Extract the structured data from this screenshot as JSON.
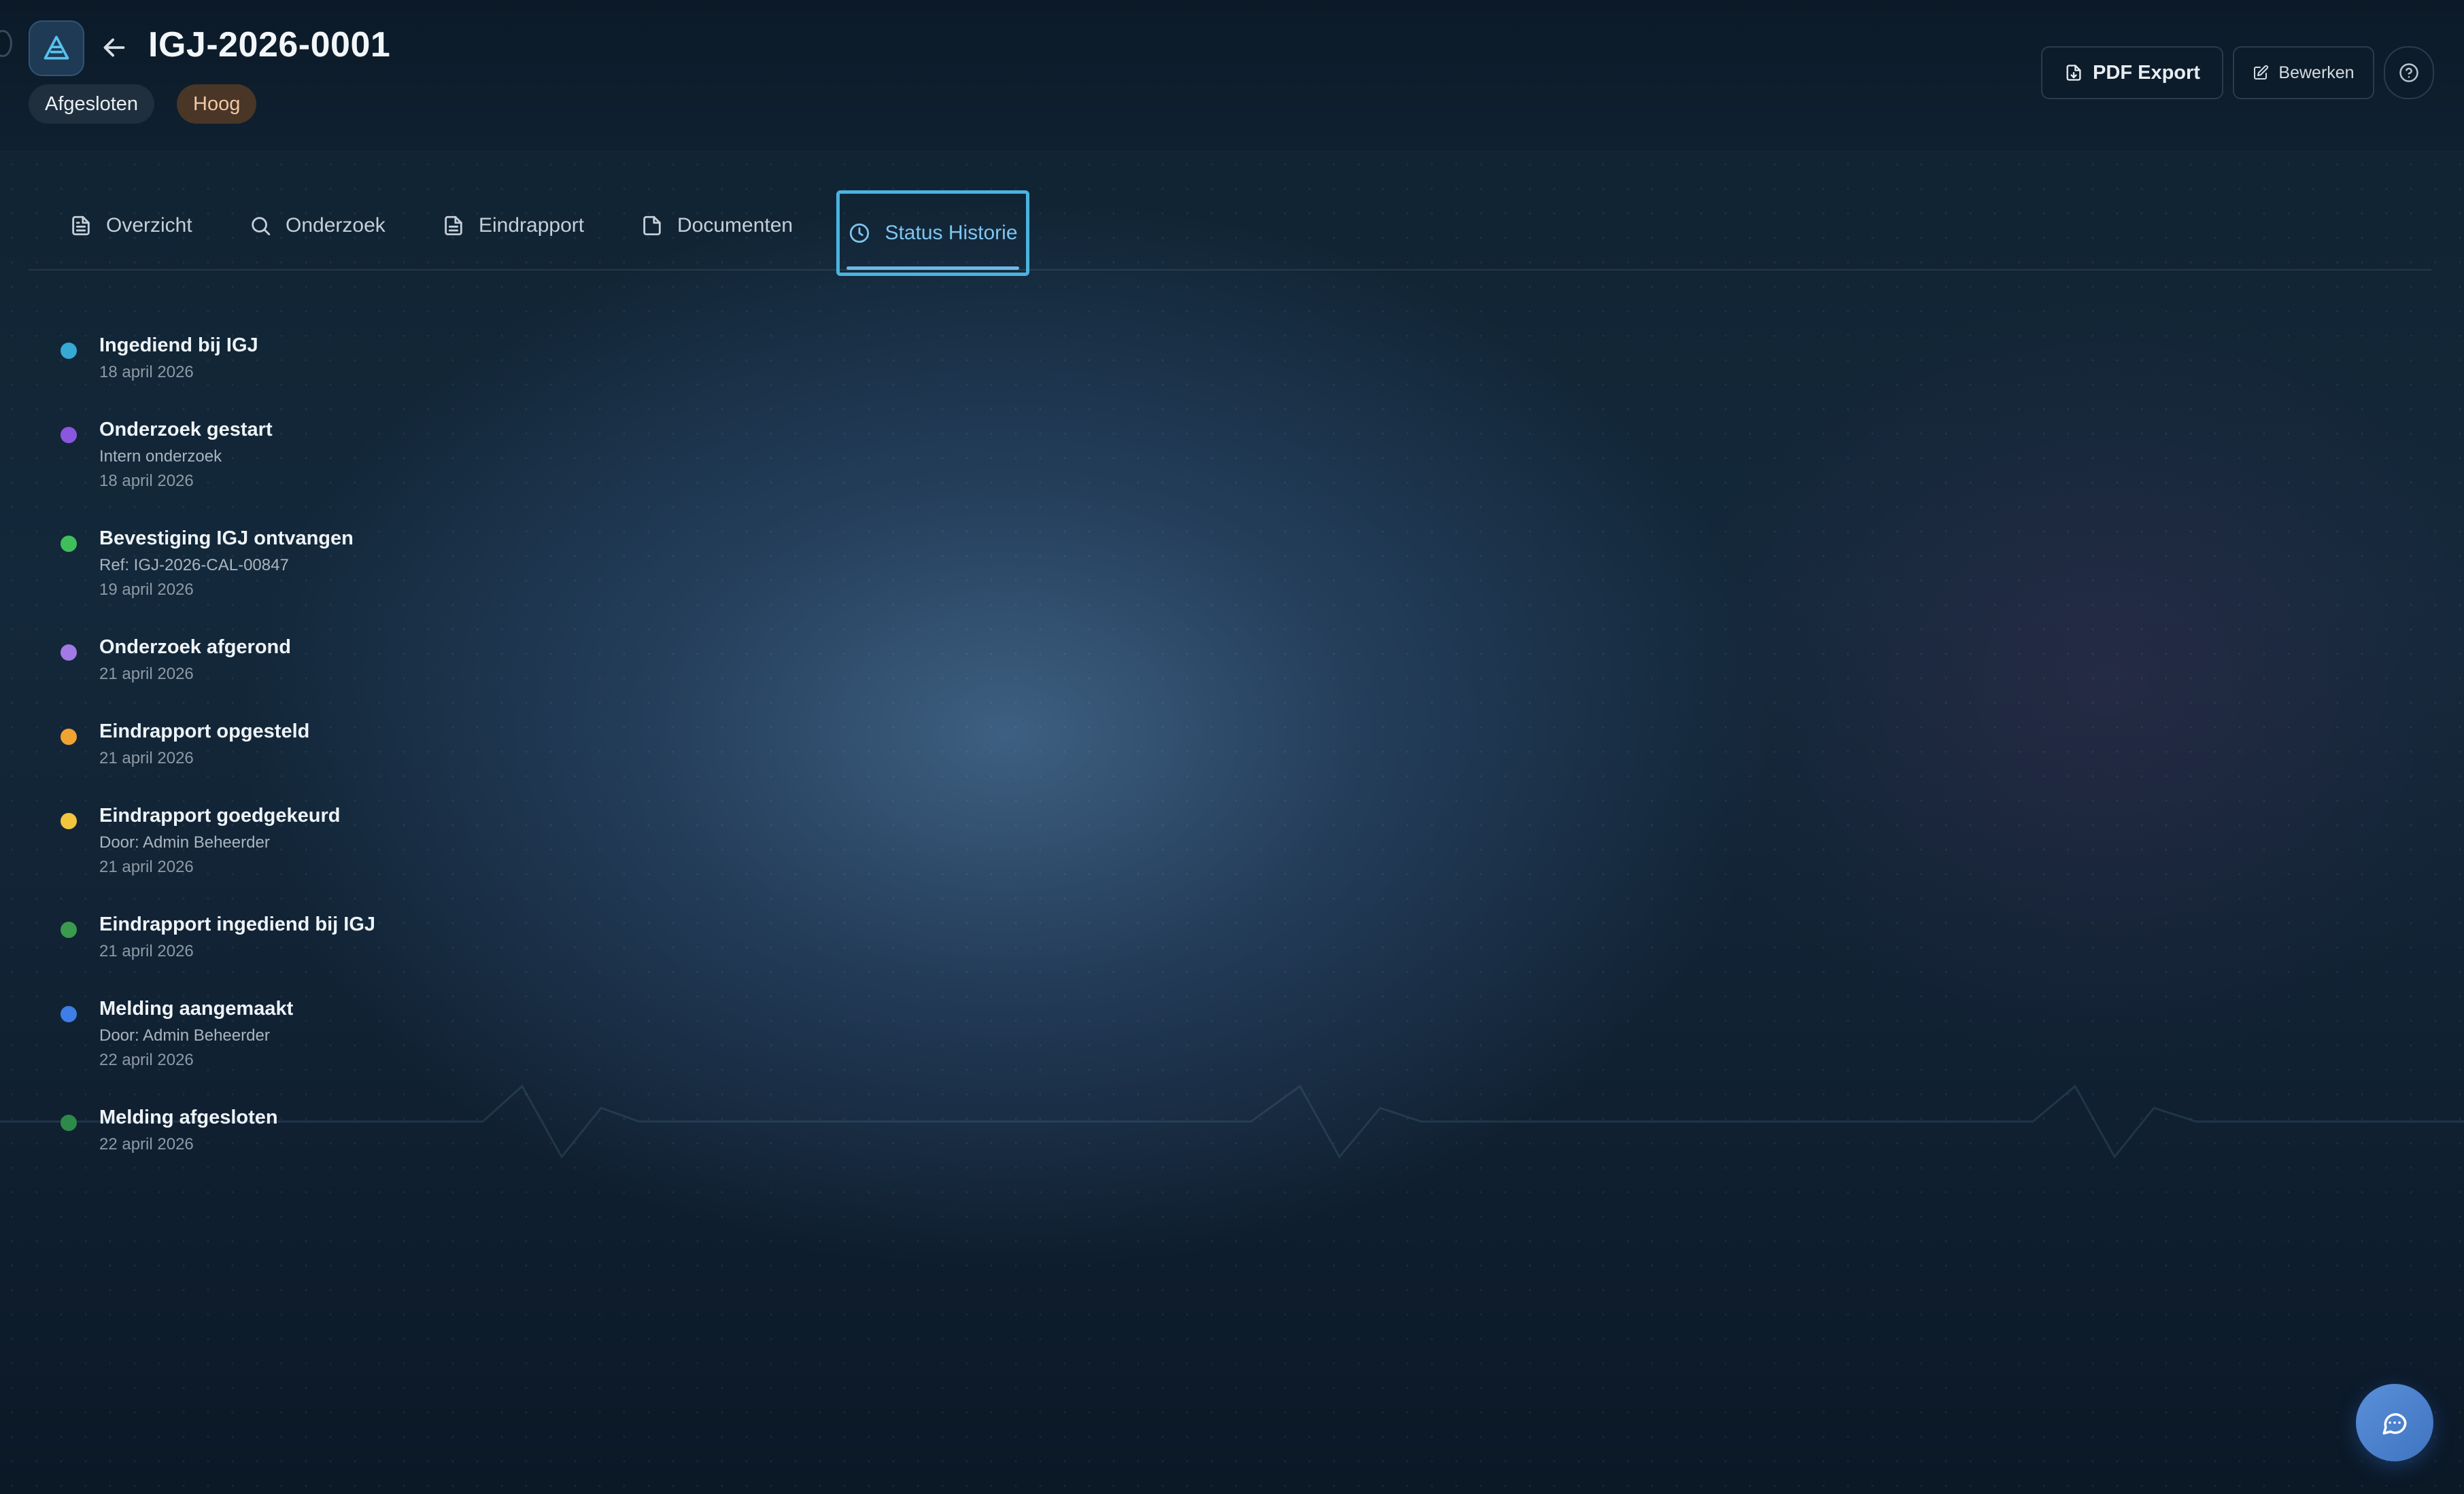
{
  "header": {
    "case_id": "IGJ-2026-0001",
    "status_badge": "Afgesloten",
    "priority_badge": "Hoog",
    "pdf_export_label": "PDF Export",
    "edit_label": "Bewerken"
  },
  "tabs": [
    {
      "label": "Overzicht",
      "icon": "document-icon"
    },
    {
      "label": "Onderzoek",
      "icon": "search-icon"
    },
    {
      "label": "Eindrapport",
      "icon": "report-icon"
    },
    {
      "label": "Documenten",
      "icon": "file-icon"
    },
    {
      "label": "Status Historie",
      "icon": "clock-icon",
      "active": true
    }
  ],
  "timeline": [
    {
      "title": "Ingediend bij IGJ",
      "date": "18 april 2026",
      "color": "#36a9d4"
    },
    {
      "title": "Onderzoek gestart",
      "detail": "Intern onderzoek",
      "date": "18 april 2026",
      "color": "#8b56e0"
    },
    {
      "title": "Bevestiging IGJ ontvangen",
      "detail": "Ref: IGJ-2026-CAL-00847",
      "date": "19 april 2026",
      "color": "#3fbf5c"
    },
    {
      "title": "Onderzoek afgerond",
      "date": "21 april 2026",
      "color": "#a27ae6"
    },
    {
      "title": "Eindrapport opgesteld",
      "date": "21 april 2026",
      "color": "#f0a331"
    },
    {
      "title": "Eindrapport goedgekeurd",
      "detail": "Door: Admin Beheerder",
      "date": "21 april 2026",
      "color": "#f2c53c"
    },
    {
      "title": "Eindrapport ingediend bij IGJ",
      "date": "21 april 2026",
      "color": "#3a9a4e"
    },
    {
      "title": "Melding aangemaakt",
      "detail": "Door: Admin Beheerder",
      "date": "22 april 2026",
      "color": "#3f7ee6"
    },
    {
      "title": "Melding afgesloten",
      "date": "22 april 2026",
      "color": "#2e8a48"
    }
  ],
  "colors": {
    "accent": "#4ab3e0",
    "priority_bg": "#4a3626",
    "status_bg": "#1f2f3e"
  }
}
